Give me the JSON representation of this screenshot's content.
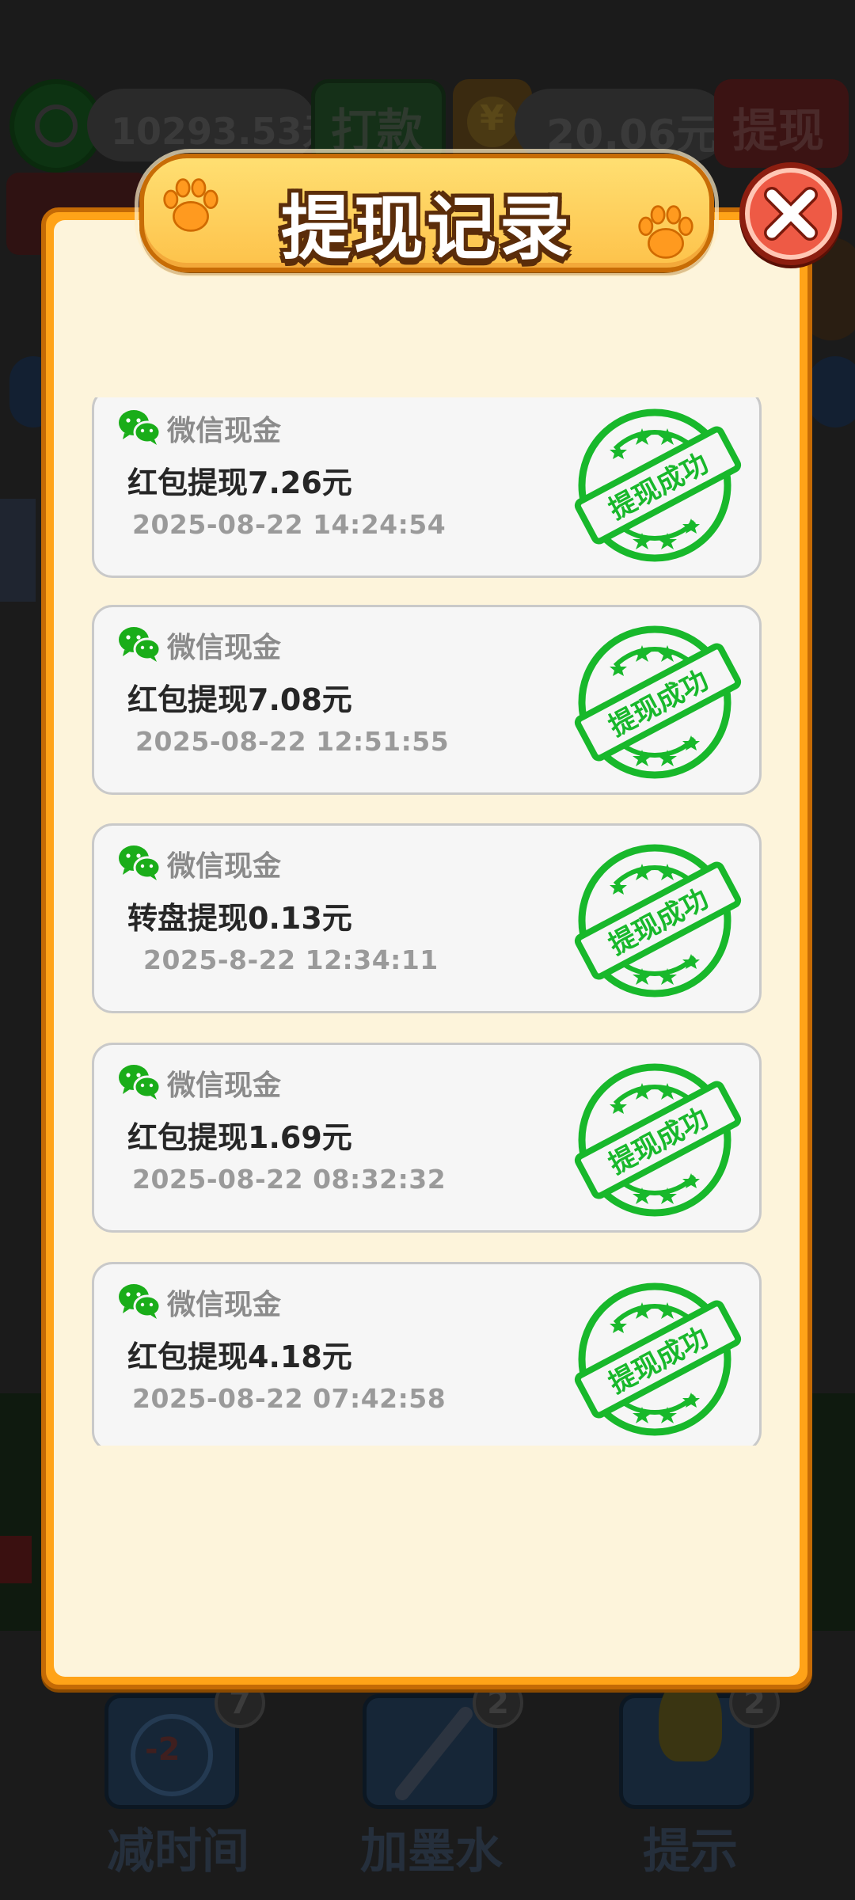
{
  "background": {
    "wallet_balance": "10293.53元",
    "pay_label": "打款",
    "coin_symbol": "¥",
    "coin_balance": "20.06元",
    "withdraw_label": "提现",
    "tools": [
      {
        "label": "减时间",
        "badge": "7",
        "value": "-2"
      },
      {
        "label": "加墨水",
        "badge": "2"
      },
      {
        "label": "提示",
        "badge": "2"
      }
    ]
  },
  "modal": {
    "title": "提现记录",
    "close_icon": "close-icon"
  },
  "records": [
    {
      "source": "微信现金",
      "title": "红包提现7.26元",
      "time": "2025-08-22 14:24:54",
      "status": "提现成功"
    },
    {
      "source": "微信现金",
      "title": "红包提现7.08元",
      "time": "2025-08-22 12:51:55",
      "status": "提现成功"
    },
    {
      "source": "微信现金",
      "title": "转盘提现0.13元",
      "time": "2025-8-22 12:34:11",
      "status": "提现成功"
    },
    {
      "source": "微信现金",
      "title": "红包提现1.69元",
      "time": "2025-08-22 08:32:32",
      "status": "提现成功"
    },
    {
      "source": "微信现金",
      "title": "红包提现4.18元",
      "time": "2025-08-22 07:42:58",
      "status": "提现成功"
    }
  ],
  "colors": {
    "stamp_green": "#18b82b",
    "wechat_green": "#1aad19",
    "modal_orange": "#ffa318",
    "close_red": "#ee5a45"
  }
}
